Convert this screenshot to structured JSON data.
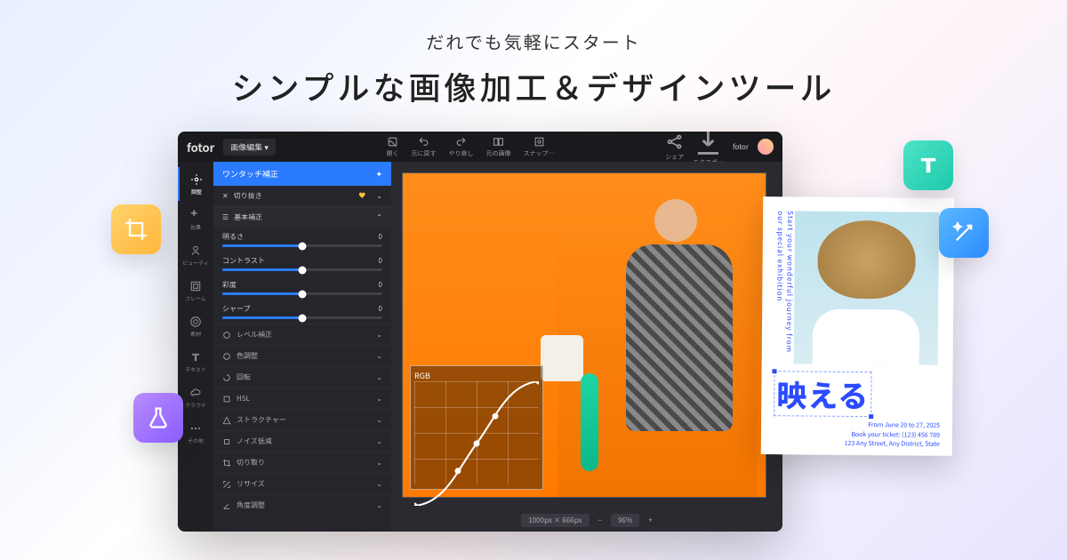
{
  "hero": {
    "subtitle": "だれでも気軽にスタート",
    "title": "シンプルな画像加工＆デザインツール"
  },
  "editor": {
    "logo": "fotor",
    "mode_dropdown": "画像編集",
    "topbar": {
      "open": "開く",
      "undo": "元に戻す",
      "redo": "やり直し",
      "compare": "元の画像",
      "snap": "スナップ…",
      "share": "シェア",
      "export": "エクスポ…"
    },
    "user": "fotor",
    "rail": [
      {
        "label": "調整"
      },
      {
        "label": "効果"
      },
      {
        "label": "ビューティ"
      },
      {
        "label": "フレーム"
      },
      {
        "label": "素材"
      },
      {
        "label": "テキスト"
      },
      {
        "label": "クラウド"
      },
      {
        "label": "その他"
      }
    ],
    "panel": {
      "one_tap": "ワンタッチ補正",
      "crop": "切り抜き",
      "basic": "基本補正",
      "sliders": [
        {
          "label": "明るさ",
          "value": "0"
        },
        {
          "label": "コントラスト",
          "value": "0"
        },
        {
          "label": "彩度",
          "value": "0"
        },
        {
          "label": "シャープ",
          "value": "0"
        }
      ],
      "rows": [
        "レベル補正",
        "色調整",
        "回転",
        "HSL",
        "ストラクチャー",
        "ノイズ低減",
        "切り取り",
        "リサイズ",
        "角度調整"
      ]
    },
    "canvas": {
      "rgb_label": "RGB",
      "dimensions": "1000px × 666px",
      "zoom": "96%"
    }
  },
  "poster": {
    "side_text": "Start your wonderful journey from our special exhibition",
    "big_text": "映える",
    "lines": [
      "From June 20 to 27, 2025",
      "Book your ticket: (123) 456 789",
      "123 Any Street, Any District, State"
    ]
  },
  "tiles": {
    "crop": "crop-icon",
    "flask": "flask-icon",
    "text": "text-icon",
    "wand": "wand-icon"
  }
}
